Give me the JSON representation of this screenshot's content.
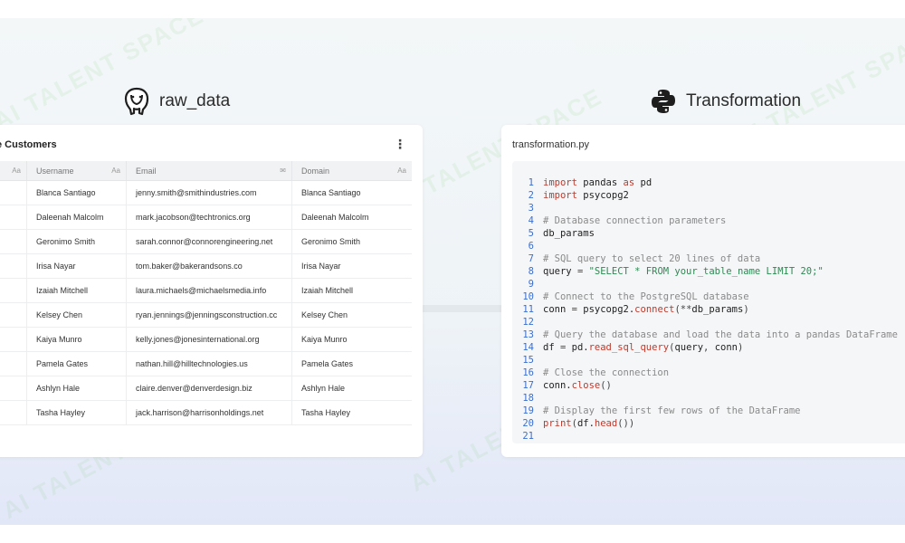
{
  "left_section": {
    "title": "raw_data",
    "icon": "postgresql-elephant-icon",
    "card": {
      "title": "e Customers",
      "menu_icon": "kebab-menu-icon",
      "columns": [
        {
          "label": "",
          "type_icon": "Aa"
        },
        {
          "label": "Username",
          "type_icon": "Aa"
        },
        {
          "label": "Email",
          "type_icon": "✉"
        },
        {
          "label": "Domain",
          "type_icon": "Aa"
        }
      ],
      "rows": [
        {
          "username": "Blanca Santiago",
          "email": "jenny.smith@smithindustries.com",
          "domain": "Blanca Santiago"
        },
        {
          "username": "Daleenah Malcolm",
          "email": "mark.jacobson@techtronics.org",
          "domain": "Daleenah Malcolm"
        },
        {
          "username": "Geronimo Smith",
          "email": "sarah.connor@connorengineering.net",
          "domain": "Geronimo Smith"
        },
        {
          "username": "Irisa Nayar",
          "email": "tom.baker@bakerandsons.co",
          "domain": "Irisa Nayar"
        },
        {
          "username": "Izaiah Mitchell",
          "email": "laura.michaels@michaelsmedia.info",
          "domain": "Izaiah Mitchell"
        },
        {
          "username": "Kelsey Chen",
          "email": "ryan.jennings@jenningsconstruction.cc",
          "domain": "Kelsey Chen"
        },
        {
          "username": "Kaiya Munro",
          "email": "kelly.jones@jonesinternational.org",
          "domain": "Kaiya Munro"
        },
        {
          "username": "Pamela Gates",
          "email": "nathan.hill@hilltechnologies.us",
          "domain": "Pamela Gates"
        },
        {
          "username": "Ashlyn Hale",
          "email": "claire.denver@denverdesign.biz",
          "domain": "Ashlyn Hale"
        },
        {
          "username": "Tasha Hayley",
          "email": "jack.harrison@harrisonholdings.net",
          "domain": "Tasha Hayley"
        }
      ]
    }
  },
  "right_section": {
    "title": "Transformation",
    "icon": "python-logo-icon",
    "file_name": "transformation.py",
    "code_lines": [
      {
        "n": "1",
        "parts": [
          [
            "kw",
            "import"
          ],
          [
            "lc",
            " pandas "
          ],
          [
            "kw",
            "as"
          ],
          [
            "lc",
            " pd"
          ]
        ]
      },
      {
        "n": "2",
        "parts": [
          [
            "kw",
            "import"
          ],
          [
            "lc",
            " psycopg2"
          ]
        ]
      },
      {
        "n": "3",
        "parts": []
      },
      {
        "n": "4",
        "parts": [
          [
            "cm",
            "# Database connection parameters"
          ]
        ]
      },
      {
        "n": "5",
        "parts": [
          [
            "lc",
            "db_params"
          ]
        ]
      },
      {
        "n": "6",
        "parts": []
      },
      {
        "n": "7",
        "parts": [
          [
            "cm",
            "# SQL query to select 20 lines of data"
          ]
        ]
      },
      {
        "n": "8",
        "parts": [
          [
            "lc",
            "query "
          ],
          [
            "pu",
            "= "
          ],
          [
            "st",
            "\"SELECT * FROM your_table_name LIMIT 20;\""
          ]
        ]
      },
      {
        "n": "9",
        "parts": []
      },
      {
        "n": "10",
        "parts": [
          [
            "cm",
            "# Connect to the PostgreSQL database"
          ]
        ]
      },
      {
        "n": "11",
        "parts": [
          [
            "lc",
            "conn "
          ],
          [
            "pu",
            "= "
          ],
          [
            "lc",
            "psycopg2."
          ],
          [
            "fn",
            "connect"
          ],
          [
            "pu",
            "(**"
          ],
          [
            "lc",
            "db_params"
          ],
          [
            "pu",
            ")"
          ]
        ]
      },
      {
        "n": "12",
        "parts": []
      },
      {
        "n": "13",
        "parts": [
          [
            "cm",
            "# Query the database and load the data into a pandas DataFrame"
          ]
        ]
      },
      {
        "n": "14",
        "parts": [
          [
            "lc",
            "df "
          ],
          [
            "pu",
            "= "
          ],
          [
            "lc",
            "pd."
          ],
          [
            "fn",
            "read_sql_query"
          ],
          [
            "pu",
            "("
          ],
          [
            "lc",
            "query"
          ],
          [
            "pu",
            ", "
          ],
          [
            "lc",
            "conn"
          ],
          [
            "pu",
            ")"
          ]
        ]
      },
      {
        "n": "15",
        "parts": []
      },
      {
        "n": "16",
        "parts": [
          [
            "cm",
            "# Close the connection"
          ]
        ]
      },
      {
        "n": "17",
        "parts": [
          [
            "lc",
            "conn."
          ],
          [
            "fn",
            "close"
          ],
          [
            "pu",
            "()"
          ]
        ]
      },
      {
        "n": "18",
        "parts": []
      },
      {
        "n": "19",
        "parts": [
          [
            "cm",
            "# Display the first few rows of the DataFrame"
          ]
        ]
      },
      {
        "n": "20",
        "parts": [
          [
            "fn",
            "print"
          ],
          [
            "pu",
            "("
          ],
          [
            "lc",
            "df."
          ],
          [
            "fn",
            "head"
          ],
          [
            "pu",
            "())"
          ]
        ]
      },
      {
        "n": "21",
        "parts": []
      }
    ]
  },
  "watermark_text": "AI TALENT SPACE",
  "colors": {
    "background_top": "#f3f7f8",
    "background_bottom": "#e2e7f8",
    "keyword": "#c0392b",
    "comment": "#8a8a8a",
    "string": "#2c8a52",
    "line_number": "#3a6fd0"
  }
}
